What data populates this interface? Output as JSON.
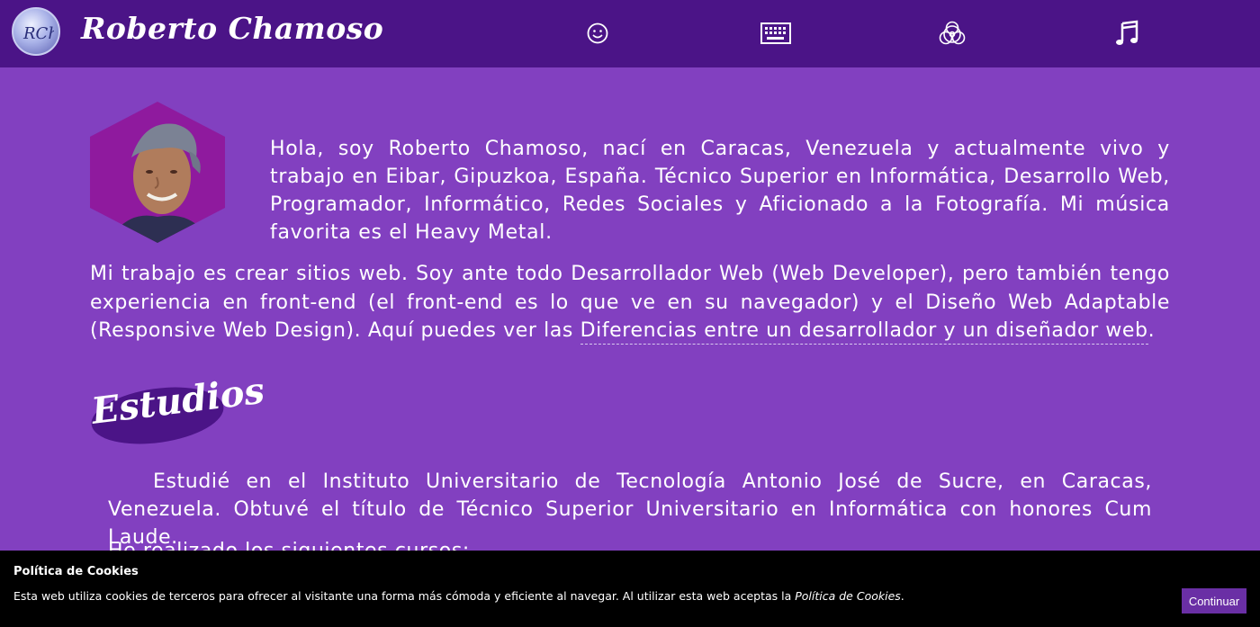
{
  "header": {
    "site_title": "Roberto Chamoso",
    "logo_text": "RCh",
    "nav": [
      {
        "icon": "smiley-icon",
        "target": "about"
      },
      {
        "icon": "keyboard-icon",
        "target": "development"
      },
      {
        "icon": "biohazard-icon",
        "target": "metal"
      },
      {
        "icon": "music-note-icon",
        "target": "music"
      }
    ]
  },
  "intro": {
    "text": "Hola, soy Roberto Chamoso, nací en Caracas, Venezuela y actualmente vivo y trabajo en Eibar, Gipuzkoa, España. Técnico Superior en Informática, Desarrollo Web, Programador, Informático, Redes Sociales y Aficionado a la Fotografía. Mi música favorita es el Heavy Metal."
  },
  "work": {
    "text": "Mi trabajo es crear sitios web. Soy ante todo Desarrollador Web (Web Developer), pero también tengo experiencia en front-end (el front-end es lo que ve en su navegador) y el Diseño Web Adaptable (Responsive Web Design). Aquí puedes ver las ",
    "link_text": "Diferencias entre un desarrollador y un diseñador web",
    "after_link": "."
  },
  "studies": {
    "heading": "Estudios",
    "text": "Estudié en el Instituto Universitario de Tecnología Antonio José de Sucre, en Caracas, Venezuela. Obtuvé el título de Técnico Superior Universitario en Informática con honores Cum Laude.",
    "courses_intro": "He realizado los siguientes cursos:"
  },
  "cookies": {
    "title": "Política de Cookies",
    "text": "Esta web utiliza cookies de terceros para ofrecer al visitante una forma más cómoda y eficiente al navegar. Al utilizar esta web aceptas la ",
    "link_text": "Política de Cookies",
    "after_link": ".",
    "button_label": "Continuar"
  },
  "colors": {
    "background": "#8240c0",
    "header": "#4b1487",
    "hexagon": "#8f1a9e",
    "badge": "#4b1487",
    "cookie_bar": "#000000",
    "button": "#6a2fa5"
  }
}
